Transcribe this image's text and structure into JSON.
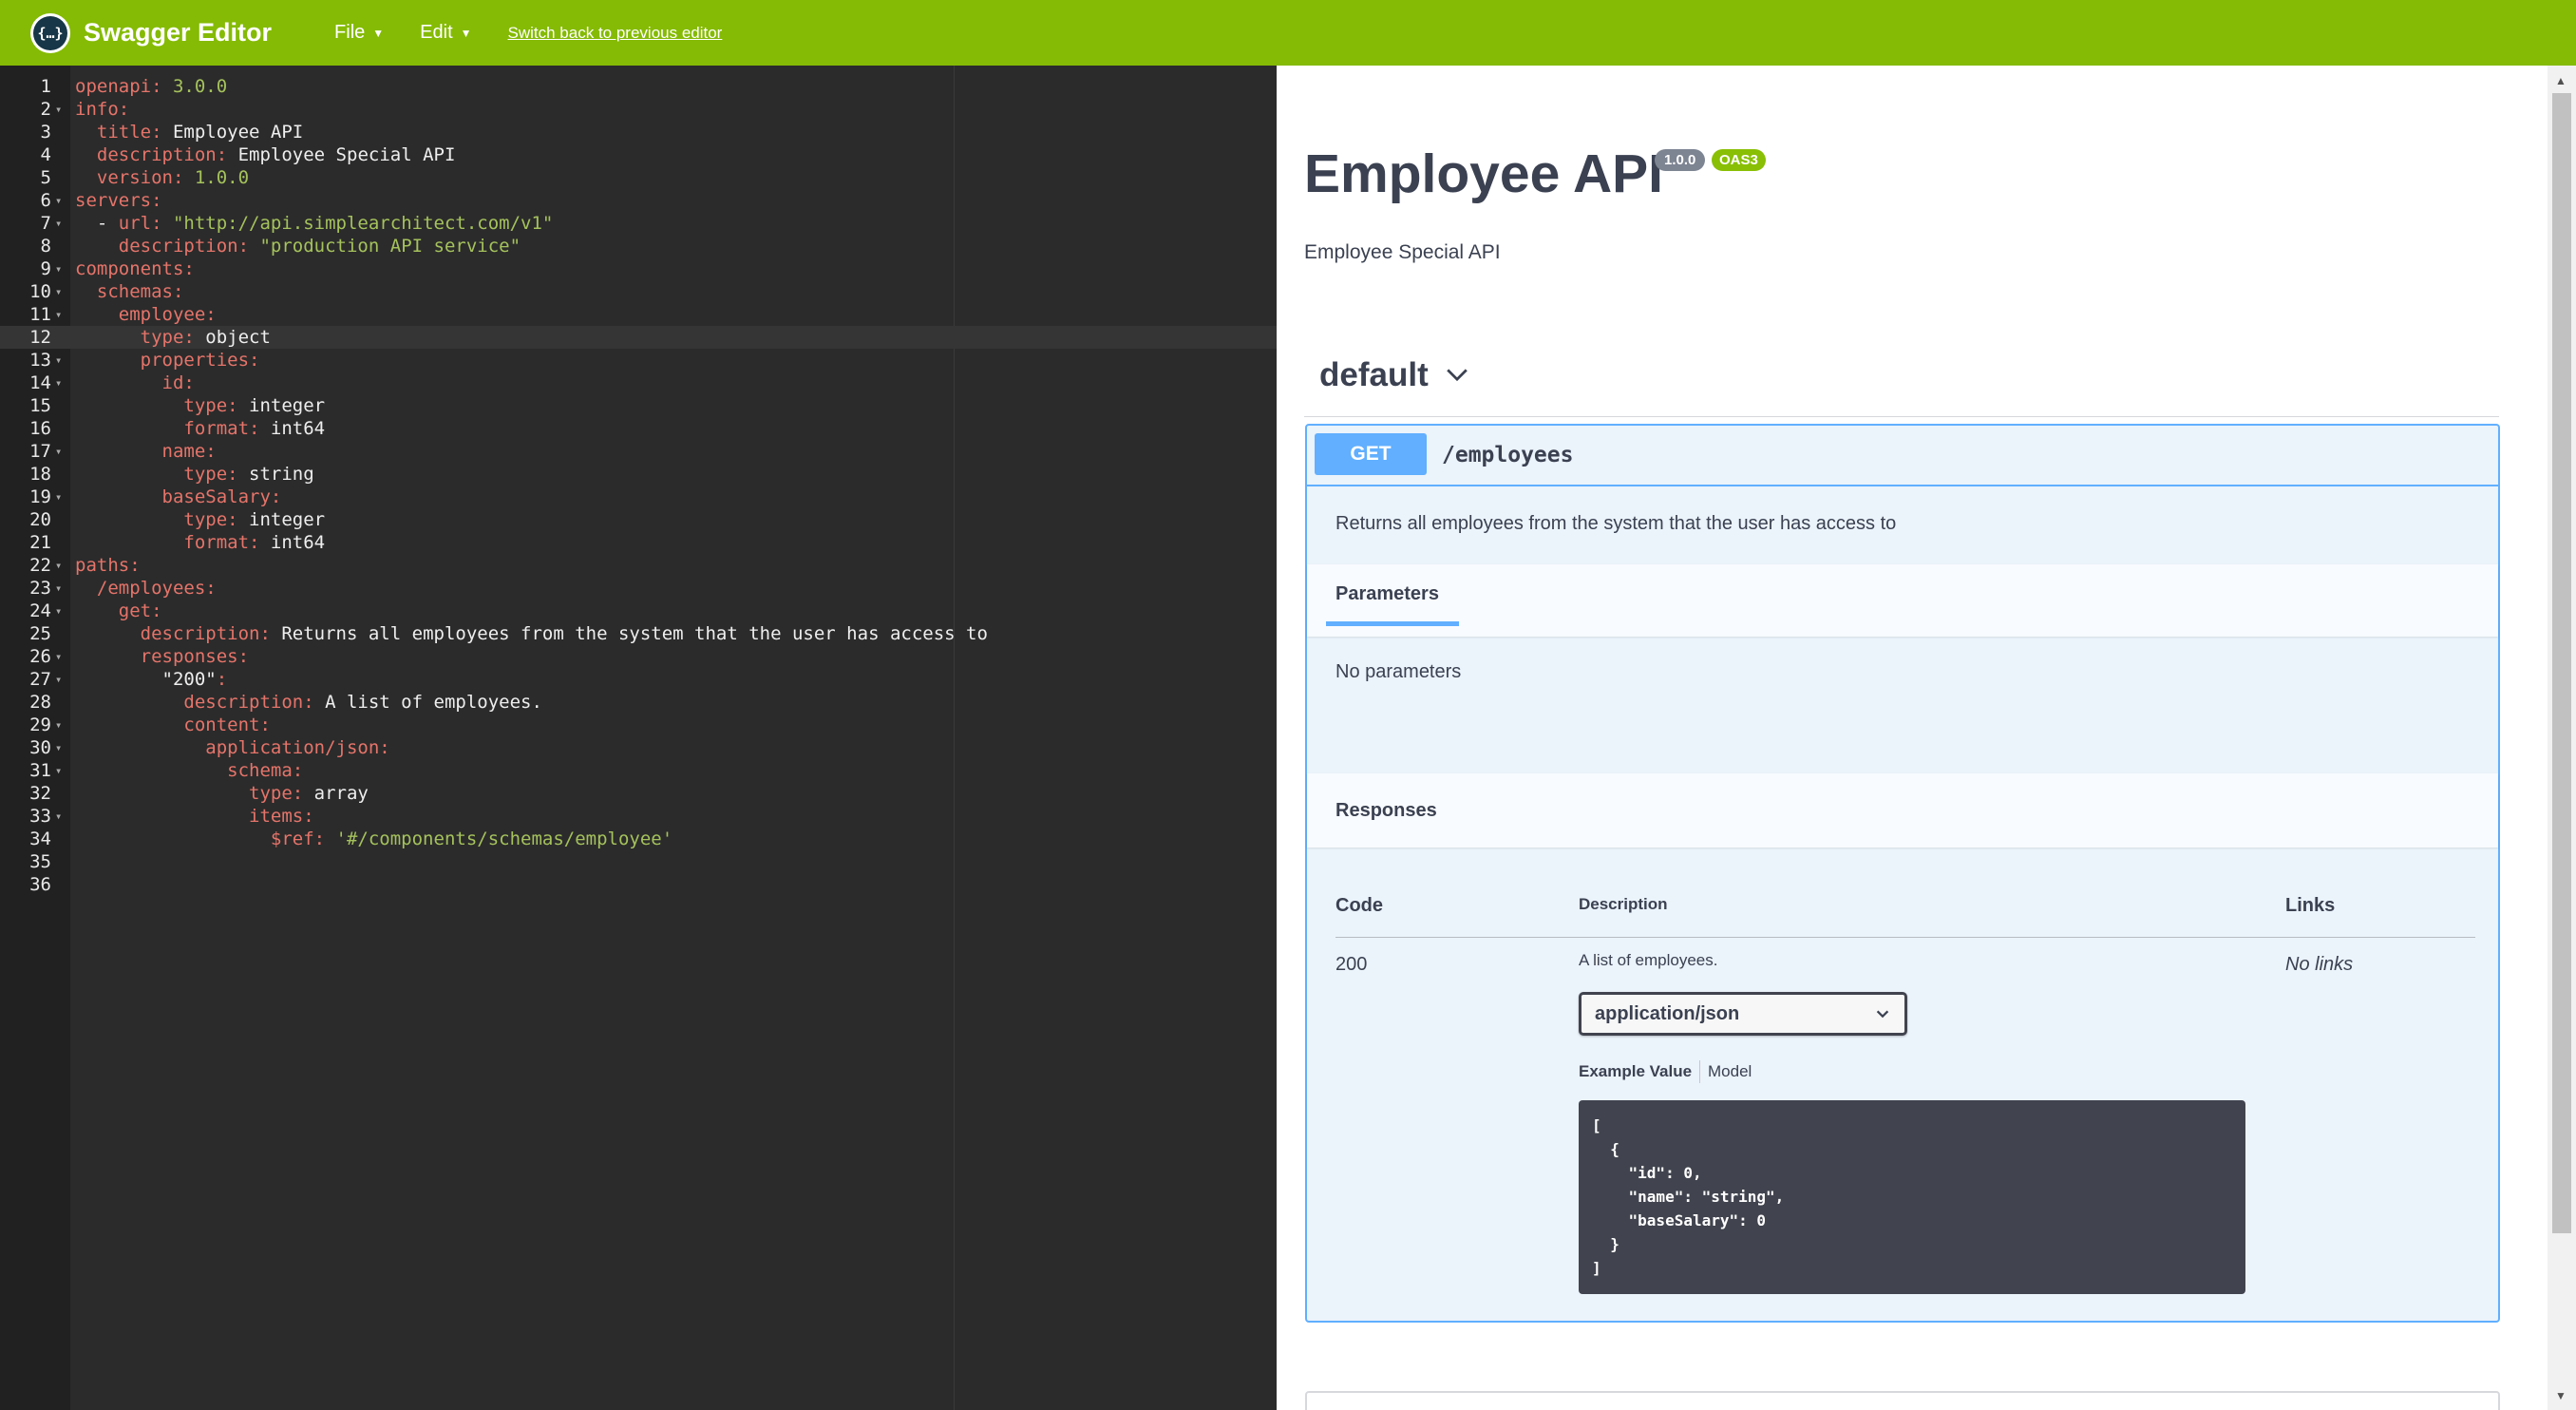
{
  "app": {
    "title": "Swagger Editor",
    "logo_glyph": "{…}",
    "menu": [
      {
        "label": "File",
        "caret": "▼"
      },
      {
        "label": "Edit",
        "caret": "▼"
      }
    ],
    "switch_link": "Switch back to previous editor",
    "accent_color": "#85bb04"
  },
  "editor": {
    "active_line": 12,
    "lines": [
      {
        "n": "1",
        "fold": false,
        "parts": [
          [
            "k",
            "openapi:"
          ],
          [
            "s",
            " 3.0.0"
          ]
        ]
      },
      {
        "n": "2",
        "fold": true,
        "parts": [
          [
            "k",
            "info:"
          ]
        ]
      },
      {
        "n": "3",
        "fold": false,
        "parts": [
          [
            "p",
            "  "
          ],
          [
            "k",
            "title:"
          ],
          [
            "p",
            " Employee API"
          ]
        ]
      },
      {
        "n": "4",
        "fold": false,
        "parts": [
          [
            "p",
            "  "
          ],
          [
            "k",
            "description:"
          ],
          [
            "p",
            " Employee Special API"
          ]
        ]
      },
      {
        "n": "5",
        "fold": false,
        "parts": [
          [
            "p",
            "  "
          ],
          [
            "k",
            "version:"
          ],
          [
            "s",
            " 1.0.0"
          ]
        ]
      },
      {
        "n": "6",
        "fold": true,
        "parts": [
          [
            "k",
            "servers:"
          ]
        ]
      },
      {
        "n": "7",
        "fold": true,
        "parts": [
          [
            "p",
            "  - "
          ],
          [
            "k",
            "url:"
          ],
          [
            "s",
            " \"http://api.simplearchitect.com/v1\""
          ]
        ]
      },
      {
        "n": "8",
        "fold": false,
        "parts": [
          [
            "p",
            "    "
          ],
          [
            "k",
            "description:"
          ],
          [
            "s",
            " \"production API service\""
          ]
        ]
      },
      {
        "n": "9",
        "fold": true,
        "parts": [
          [
            "k",
            "components:"
          ]
        ]
      },
      {
        "n": "10",
        "fold": true,
        "parts": [
          [
            "p",
            "  "
          ],
          [
            "k",
            "schemas:"
          ]
        ]
      },
      {
        "n": "11",
        "fold": true,
        "parts": [
          [
            "p",
            "    "
          ],
          [
            "k",
            "employee:"
          ]
        ]
      },
      {
        "n": "12",
        "fold": false,
        "parts": [
          [
            "p",
            "      "
          ],
          [
            "k",
            "type:"
          ],
          [
            "p",
            " object"
          ]
        ]
      },
      {
        "n": "13",
        "fold": true,
        "parts": [
          [
            "p",
            "      "
          ],
          [
            "k",
            "properties:"
          ]
        ]
      },
      {
        "n": "14",
        "fold": true,
        "parts": [
          [
            "p",
            "        "
          ],
          [
            "k",
            "id:"
          ]
        ]
      },
      {
        "n": "15",
        "fold": false,
        "parts": [
          [
            "p",
            "          "
          ],
          [
            "k",
            "type:"
          ],
          [
            "p",
            " integer"
          ]
        ]
      },
      {
        "n": "16",
        "fold": false,
        "parts": [
          [
            "p",
            "          "
          ],
          [
            "k",
            "format:"
          ],
          [
            "p",
            " int64"
          ]
        ]
      },
      {
        "n": "17",
        "fold": true,
        "parts": [
          [
            "p",
            "        "
          ],
          [
            "k",
            "name:"
          ]
        ]
      },
      {
        "n": "18",
        "fold": false,
        "parts": [
          [
            "p",
            "          "
          ],
          [
            "k",
            "type:"
          ],
          [
            "p",
            " string"
          ]
        ]
      },
      {
        "n": "19",
        "fold": true,
        "parts": [
          [
            "p",
            "        "
          ],
          [
            "k",
            "baseSalary:"
          ]
        ]
      },
      {
        "n": "20",
        "fold": false,
        "parts": [
          [
            "p",
            "          "
          ],
          [
            "k",
            "type:"
          ],
          [
            "p",
            " integer"
          ]
        ]
      },
      {
        "n": "21",
        "fold": false,
        "parts": [
          [
            "p",
            "          "
          ],
          [
            "k",
            "format:"
          ],
          [
            "p",
            " int64"
          ]
        ]
      },
      {
        "n": "22",
        "fold": true,
        "parts": [
          [
            "k",
            "paths:"
          ]
        ]
      },
      {
        "n": "23",
        "fold": true,
        "parts": [
          [
            "p",
            "  "
          ],
          [
            "k",
            "/employees:"
          ]
        ]
      },
      {
        "n": "24",
        "fold": true,
        "parts": [
          [
            "p",
            "    "
          ],
          [
            "k",
            "get:"
          ]
        ]
      },
      {
        "n": "25",
        "fold": false,
        "parts": [
          [
            "p",
            "      "
          ],
          [
            "k",
            "description:"
          ],
          [
            "p",
            " Returns all employees from the system that the user has access to"
          ]
        ]
      },
      {
        "n": "26",
        "fold": true,
        "parts": [
          [
            "p",
            "      "
          ],
          [
            "k",
            "responses:"
          ]
        ]
      },
      {
        "n": "27",
        "fold": true,
        "parts": [
          [
            "p",
            "        "
          ],
          [
            "p",
            "\"200\""
          ],
          [
            "k",
            ":"
          ]
        ]
      },
      {
        "n": "28",
        "fold": false,
        "parts": [
          [
            "p",
            "          "
          ],
          [
            "k",
            "description:"
          ],
          [
            "p",
            " A list of employees."
          ]
        ]
      },
      {
        "n": "29",
        "fold": true,
        "parts": [
          [
            "p",
            "          "
          ],
          [
            "k",
            "content:"
          ]
        ]
      },
      {
        "n": "30",
        "fold": true,
        "parts": [
          [
            "p",
            "            "
          ],
          [
            "k",
            "application/json:"
          ]
        ]
      },
      {
        "n": "31",
        "fold": true,
        "parts": [
          [
            "p",
            "              "
          ],
          [
            "k",
            "schema:"
          ]
        ]
      },
      {
        "n": "32",
        "fold": false,
        "parts": [
          [
            "p",
            "                "
          ],
          [
            "k",
            "type:"
          ],
          [
            "p",
            " array"
          ]
        ]
      },
      {
        "n": "33",
        "fold": true,
        "parts": [
          [
            "p",
            "                "
          ],
          [
            "k",
            "items:"
          ]
        ]
      },
      {
        "n": "34",
        "fold": false,
        "parts": [
          [
            "p",
            "                  "
          ],
          [
            "k",
            "$ref:"
          ],
          [
            "s",
            " '#/components/schemas/employee'"
          ]
        ]
      },
      {
        "n": "35",
        "fold": false,
        "parts": []
      },
      {
        "n": "36",
        "fold": false,
        "parts": []
      }
    ]
  },
  "preview": {
    "title": "Employee API",
    "version_badge": "1.0.0",
    "oas_badge": "OAS3",
    "description": "Employee Special API",
    "tag": "default",
    "operation": {
      "method": "GET",
      "path": "/employees",
      "description": "Returns all employees from the system that the user has access to",
      "parameters_tab": "Parameters",
      "no_parameters": "No parameters",
      "responses_title": "Responses",
      "table_headers": {
        "code": "Code",
        "description": "Description",
        "links": "Links"
      },
      "responses": [
        {
          "code": "200",
          "description": "A list of employees.",
          "media_type": "application/json",
          "links": "No links",
          "example_tab": "Example Value",
          "model_tab": "Model",
          "example": "[\n  {\n    \"id\": 0,\n    \"name\": \"string\",\n    \"baseSalary\": 0\n  }\n]"
        }
      ]
    },
    "method_color": "#61affe"
  }
}
